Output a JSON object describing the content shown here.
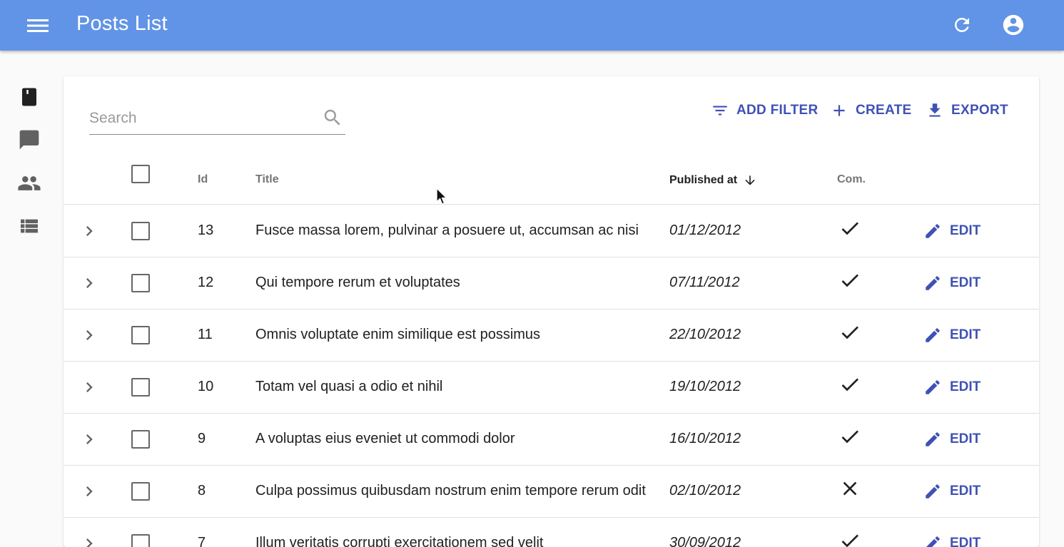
{
  "appbar": {
    "title": "Posts List",
    "menu_icon": "menu-icon",
    "refresh_icon": "refresh-icon",
    "account_icon": "account-circle-icon",
    "color": "#6194e6"
  },
  "sidebar": {
    "items": [
      {
        "icon": "book-icon",
        "active": true
      },
      {
        "icon": "comment-icon",
        "active": false
      },
      {
        "icon": "people-icon",
        "active": false
      },
      {
        "icon": "view-list-icon",
        "active": false
      }
    ]
  },
  "search": {
    "placeholder": "Search",
    "value": ""
  },
  "toolbar": {
    "add_filter_label": "ADD FILTER",
    "create_label": "CREATE",
    "export_label": "EXPORT",
    "accent": "#3f51b5"
  },
  "table": {
    "headers": {
      "id": "Id",
      "title": "Title",
      "published_at": "Published at",
      "commentable": "Com."
    },
    "sort": {
      "column": "published_at",
      "direction": "desc"
    },
    "edit_label": "EDIT",
    "rows": [
      {
        "id": "13",
        "title": "Fusce massa lorem, pulvinar a posuere ut, accumsan ac nisi",
        "published_at": "01/12/2012",
        "commentable": true
      },
      {
        "id": "12",
        "title": "Qui tempore rerum et voluptates",
        "published_at": "07/11/2012",
        "commentable": true
      },
      {
        "id": "11",
        "title": "Omnis voluptate enim similique est possimus",
        "published_at": "22/10/2012",
        "commentable": true
      },
      {
        "id": "10",
        "title": "Totam vel quasi a odio et nihil",
        "published_at": "19/10/2012",
        "commentable": true
      },
      {
        "id": "9",
        "title": "A voluptas eius eveniet ut commodi dolor",
        "published_at": "16/10/2012",
        "commentable": true
      },
      {
        "id": "8",
        "title": "Culpa possimus quibusdam nostrum enim tempore rerum odit",
        "published_at": "02/10/2012",
        "commentable": false
      },
      {
        "id": "7",
        "title": "Illum veritatis corrupti exercitationem sed velit",
        "published_at": "30/09/2012",
        "commentable": true
      }
    ]
  }
}
